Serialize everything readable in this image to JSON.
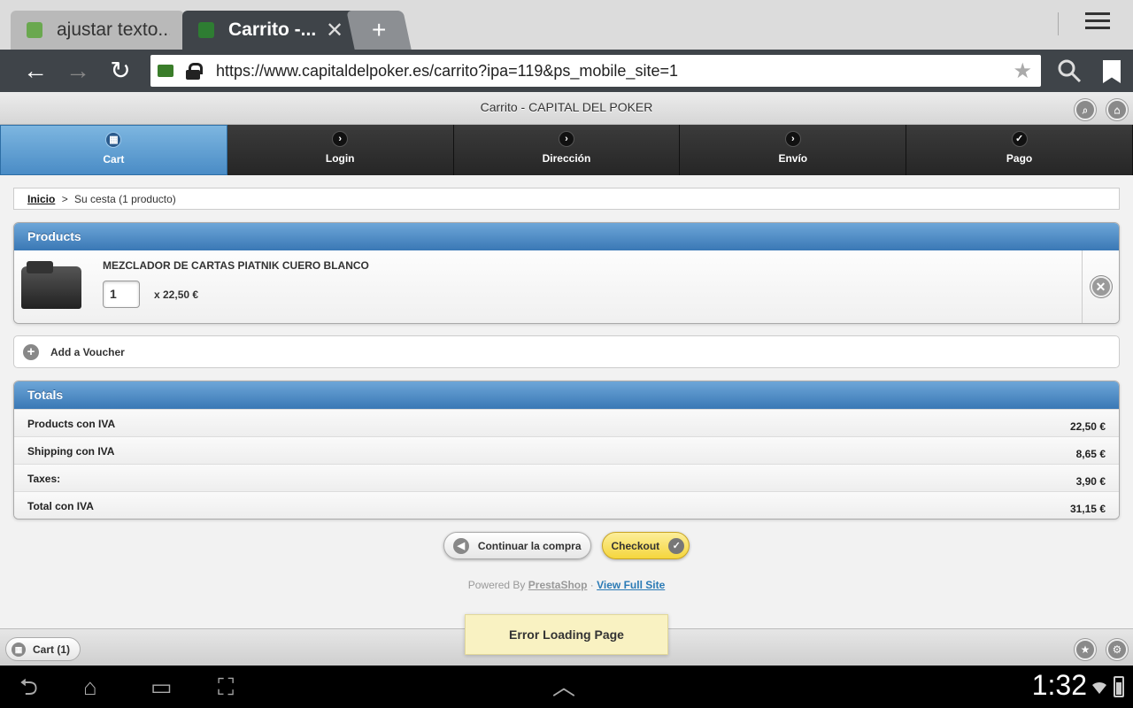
{
  "browser": {
    "tabs": [
      {
        "title": "ajustar texto..."
      },
      {
        "title": "Carrito -..."
      }
    ],
    "new_tab_label": "+",
    "close_tab_label": "✕",
    "url": "https://www.capitaldelpoker.es/carrito?ipa=119&ps_mobile_site=1"
  },
  "page": {
    "title": "Carrito - CAPITAL DEL POKER",
    "steps": [
      {
        "label": "Cart",
        "icon": "grid-icon",
        "active": true
      },
      {
        "label": "Login",
        "icon": "chevron-right-icon"
      },
      {
        "label": "Dirección",
        "icon": "chevron-right-icon"
      },
      {
        "label": "Envío",
        "icon": "chevron-right-icon"
      },
      {
        "label": "Pago",
        "icon": "check-icon"
      }
    ],
    "breadcrumb": {
      "home": "Inicio",
      "separator": ">",
      "current": "Su cesta (1 producto)"
    },
    "products": {
      "header": "Products",
      "items": [
        {
          "name": "MEZCLADOR DE CARTAS PIATNIK CUERO BLANCO",
          "quantity": "1",
          "price_text": "x 22,50 €"
        }
      ]
    },
    "voucher_label": "Add a Voucher",
    "totals": {
      "header": "Totals",
      "rows": [
        {
          "label": "Products con IVA",
          "value": "22,50 €"
        },
        {
          "label": "Shipping con IVA",
          "value": "8,65 €"
        },
        {
          "label": "Taxes:",
          "value": "3,90 €"
        },
        {
          "label": "Total con IVA",
          "value": "31,15 €"
        }
      ]
    },
    "buttons": {
      "continue": "Continuar la compra",
      "checkout": "Checkout"
    },
    "powered": {
      "prefix": "Powered By",
      "prestashop": "PrestaShop",
      "dot": "·",
      "full_site": "View Full Site"
    },
    "footer": {
      "cart_label": "Cart (1)"
    },
    "error_toast": "Error Loading Page"
  },
  "android": {
    "clock": "1:32"
  },
  "colors": {
    "accent_blue": "#4a8cc6",
    "checkout_yellow": "#f5d63d",
    "toolbar_dark": "#3f4449"
  }
}
